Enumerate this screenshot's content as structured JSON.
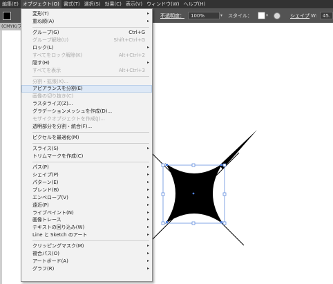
{
  "menubar": {
    "items": [
      "編集(E)",
      "オブジェクト(O)",
      "書式(T)",
      "選択(S)",
      "効果(C)",
      "表示(V)",
      "ウィンドウ(W)",
      "ヘルプ(H)"
    ],
    "active_index": 1
  },
  "controlbar": {
    "opacity_label": "不透明度：",
    "opacity_value": "100%",
    "style_label": "スタイル：",
    "shape_label": "シェイプ",
    "w_value": "45.",
    "arrow_glyph": "▾"
  },
  "doc_tab": {
    "title": "(CMYK/フ"
  },
  "menu": {
    "submenu_arrow": "▸",
    "items": [
      {
        "label": "変形(T)",
        "shortcut": "",
        "submenu": true,
        "disabled": false,
        "highlighted": false,
        "separator_after": false
      },
      {
        "label": "重ね順(A)",
        "shortcut": "",
        "submenu": true,
        "disabled": false,
        "highlighted": false,
        "separator_after": true
      },
      {
        "label": "グループ(G)",
        "shortcut": "Ctrl+G",
        "submenu": false,
        "disabled": false,
        "highlighted": false,
        "separator_after": false
      },
      {
        "label": "グループ解除(U)",
        "shortcut": "Shift+Ctrl+G",
        "submenu": false,
        "disabled": true,
        "highlighted": false,
        "separator_after": false
      },
      {
        "label": "ロック(L)",
        "shortcut": "",
        "submenu": true,
        "disabled": false,
        "highlighted": false,
        "separator_after": false
      },
      {
        "label": "すべてをロック解除(K)",
        "shortcut": "Alt+Ctrl+2",
        "submenu": false,
        "disabled": true,
        "highlighted": false,
        "separator_after": false
      },
      {
        "label": "隠す(H)",
        "shortcut": "",
        "submenu": true,
        "disabled": false,
        "highlighted": false,
        "separator_after": false
      },
      {
        "label": "すべてを表示",
        "shortcut": "Alt+Ctrl+3",
        "submenu": false,
        "disabled": true,
        "highlighted": false,
        "separator_after": true
      },
      {
        "label": "分割・拡張(X)...",
        "shortcut": "",
        "submenu": false,
        "disabled": true,
        "highlighted": false,
        "separator_after": false
      },
      {
        "label": "アピアランスを分割(E)",
        "shortcut": "",
        "submenu": false,
        "disabled": false,
        "highlighted": true,
        "separator_after": false
      },
      {
        "label": "画像の切り抜き(C)",
        "shortcut": "",
        "submenu": false,
        "disabled": true,
        "highlighted": false,
        "separator_after": false
      },
      {
        "label": "ラスタライズ(Z)...",
        "shortcut": "",
        "submenu": false,
        "disabled": false,
        "highlighted": false,
        "separator_after": false
      },
      {
        "label": "グラデーションメッシュを作成(D)...",
        "shortcut": "",
        "submenu": false,
        "disabled": false,
        "highlighted": false,
        "separator_after": false
      },
      {
        "label": "モザイクオブジェクトを作成(J)...",
        "shortcut": "",
        "submenu": false,
        "disabled": true,
        "highlighted": false,
        "separator_after": false
      },
      {
        "label": "透明部分を分割・統合(F)...",
        "shortcut": "",
        "submenu": false,
        "disabled": false,
        "highlighted": false,
        "separator_after": true
      },
      {
        "label": "ピクセルを最適化(M)",
        "shortcut": "",
        "submenu": false,
        "disabled": false,
        "highlighted": false,
        "separator_after": true
      },
      {
        "label": "スライス(S)",
        "shortcut": "",
        "submenu": true,
        "disabled": false,
        "highlighted": false,
        "separator_after": false
      },
      {
        "label": "トリムマークを作成(C)",
        "shortcut": "",
        "submenu": false,
        "disabled": false,
        "highlighted": false,
        "separator_after": true
      },
      {
        "label": "パス(P)",
        "shortcut": "",
        "submenu": true,
        "disabled": false,
        "highlighted": false,
        "separator_after": false
      },
      {
        "label": "シェイプ(P)",
        "shortcut": "",
        "submenu": true,
        "disabled": false,
        "highlighted": false,
        "separator_after": false
      },
      {
        "label": "パターン(E)",
        "shortcut": "",
        "submenu": true,
        "disabled": false,
        "highlighted": false,
        "separator_after": false
      },
      {
        "label": "ブレンド(B)",
        "shortcut": "",
        "submenu": true,
        "disabled": false,
        "highlighted": false,
        "separator_after": false
      },
      {
        "label": "エンベロープ(V)",
        "shortcut": "",
        "submenu": true,
        "disabled": false,
        "highlighted": false,
        "separator_after": false
      },
      {
        "label": "遠近(P)",
        "shortcut": "",
        "submenu": true,
        "disabled": false,
        "highlighted": false,
        "separator_after": false
      },
      {
        "label": "ライブペイント(N)",
        "shortcut": "",
        "submenu": true,
        "disabled": false,
        "highlighted": false,
        "separator_after": false
      },
      {
        "label": "画像トレース",
        "shortcut": "",
        "submenu": true,
        "disabled": false,
        "highlighted": false,
        "separator_after": false
      },
      {
        "label": "テキストの回り込み(W)",
        "shortcut": "",
        "submenu": true,
        "disabled": false,
        "highlighted": false,
        "separator_after": false
      },
      {
        "label": "Line と Sketch のアート",
        "shortcut": "",
        "submenu": true,
        "disabled": false,
        "highlighted": false,
        "separator_after": true
      },
      {
        "label": "クリッピングマスク(M)",
        "shortcut": "",
        "submenu": true,
        "disabled": false,
        "highlighted": false,
        "separator_after": false
      },
      {
        "label": "複合パス(O)",
        "shortcut": "",
        "submenu": true,
        "disabled": false,
        "highlighted": false,
        "separator_after": false
      },
      {
        "label": "アートボード(A)",
        "shortcut": "",
        "submenu": true,
        "disabled": false,
        "highlighted": false,
        "separator_after": false
      },
      {
        "label": "グラフ(R)",
        "shortcut": "",
        "submenu": true,
        "disabled": false,
        "highlighted": false,
        "separator_after": false
      }
    ]
  },
  "colors": {
    "menubar_bg": "#323232",
    "controlbar_bg": "#535353",
    "menu_bg": "#f2f2f2",
    "highlight": "#dde8f6",
    "selection_blue": "#4f7fd9",
    "shape_fill": "#000000"
  },
  "icons": {
    "fill_swatch": "fill-swatch-icon",
    "style_swatch": "style-swatch-icon",
    "recolor": "recolor-artwork-icon",
    "submenu": "chevron-right-icon",
    "anchor": "anchor-point-icon"
  }
}
